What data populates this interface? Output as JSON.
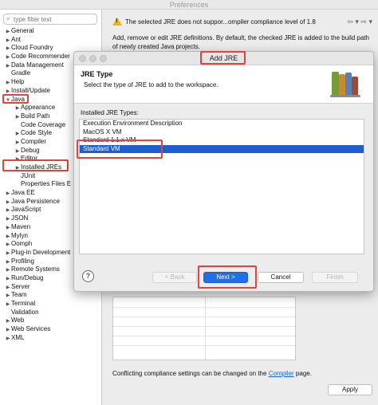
{
  "window": {
    "title": "Preferences"
  },
  "filter": {
    "placeholder": "type filter text",
    "icon": "search-icon"
  },
  "tree": {
    "items": [
      {
        "label": "General",
        "level": 0,
        "arrow": "▶"
      },
      {
        "label": "Ant",
        "level": 0,
        "arrow": "▶"
      },
      {
        "label": "Cloud Foundry",
        "level": 0,
        "arrow": "▶"
      },
      {
        "label": "Code Recommender",
        "level": 0,
        "arrow": "▶"
      },
      {
        "label": "Data Management",
        "level": 0,
        "arrow": "▶"
      },
      {
        "label": "Gradle",
        "level": 0,
        "arrow": ""
      },
      {
        "label": "Help",
        "level": 0,
        "arrow": "▶"
      },
      {
        "label": "Install/Update",
        "level": 0,
        "arrow": "▶"
      },
      {
        "label": "Java",
        "level": 0,
        "arrow": "▼"
      },
      {
        "label": "Appearance",
        "level": 1,
        "arrow": "▶"
      },
      {
        "label": "Build Path",
        "level": 1,
        "arrow": "▶"
      },
      {
        "label": "Code Coverage",
        "level": 1,
        "arrow": ""
      },
      {
        "label": "Code Style",
        "level": 1,
        "arrow": "▶"
      },
      {
        "label": "Compiler",
        "level": 1,
        "arrow": "▶"
      },
      {
        "label": "Debug",
        "level": 1,
        "arrow": "▶"
      },
      {
        "label": "Editor",
        "level": 1,
        "arrow": "▶"
      },
      {
        "label": "Installed JREs",
        "level": 1,
        "arrow": "▶"
      },
      {
        "label": "JUnit",
        "level": 1,
        "arrow": ""
      },
      {
        "label": "Properties Files E",
        "level": 1,
        "arrow": ""
      },
      {
        "label": "Java EE",
        "level": 0,
        "arrow": "▶"
      },
      {
        "label": "Java Persistence",
        "level": 0,
        "arrow": "▶"
      },
      {
        "label": "JavaScript",
        "level": 0,
        "arrow": "▶"
      },
      {
        "label": "JSON",
        "level": 0,
        "arrow": "▶"
      },
      {
        "label": "Maven",
        "level": 0,
        "arrow": "▶"
      },
      {
        "label": "Mylyn",
        "level": 0,
        "arrow": "▶"
      },
      {
        "label": "Oomph",
        "level": 0,
        "arrow": "▶"
      },
      {
        "label": "Plug-in Development",
        "level": 0,
        "arrow": "▶"
      },
      {
        "label": "Profiling",
        "level": 0,
        "arrow": "▶"
      },
      {
        "label": "Remote Systems",
        "level": 0,
        "arrow": "▶"
      },
      {
        "label": "Run/Debug",
        "level": 0,
        "arrow": "▶"
      },
      {
        "label": "Server",
        "level": 0,
        "arrow": "▶"
      },
      {
        "label": "Team",
        "level": 0,
        "arrow": "▶"
      },
      {
        "label": "Terminal",
        "level": 0,
        "arrow": "▶"
      },
      {
        "label": "Validation",
        "level": 0,
        "arrow": ""
      },
      {
        "label": "Web",
        "level": 0,
        "arrow": "▶"
      },
      {
        "label": "Web Services",
        "level": 0,
        "arrow": "▶"
      },
      {
        "label": "XML",
        "level": 0,
        "arrow": "▶"
      }
    ]
  },
  "right": {
    "warning": "The selected JRE does not suppor...ompiler compliance level of 1.8",
    "description": "Add, remove or edit JRE definitions. By default, the checked JRE is added to the build path of newly created Java projects.",
    "conflict_prefix": "Conflicting compliance settings can be changed on the ",
    "conflict_link": "Compiler",
    "conflict_suffix": " page.",
    "apply_label": "Apply"
  },
  "dialog": {
    "title": "Add JRE",
    "heading": "JRE Type",
    "subheading": "Select the type of JRE to add to the workspace.",
    "list_label": "Installed JRE Types:",
    "types": [
      "Execution Environment Description",
      "MacOS X VM",
      "Standard 1.1.x VM",
      "Standard VM"
    ],
    "selected_index": 3,
    "buttons": {
      "back": "< Back",
      "next": "Next >",
      "cancel": "Cancel",
      "finish": "Finish",
      "help": "?"
    }
  },
  "colors": {
    "highlight": "#e0443a",
    "selection": "#1d5fd1",
    "primary": "#1f6fe6",
    "warning": "#f5b400"
  }
}
